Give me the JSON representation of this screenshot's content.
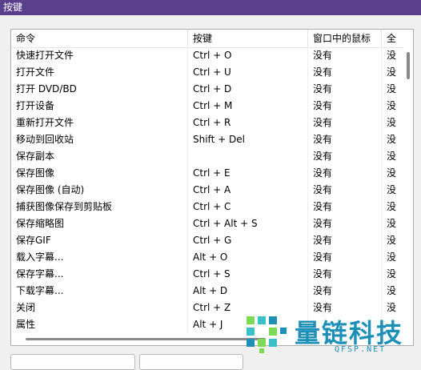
{
  "window": {
    "title": "按键"
  },
  "table": {
    "headers": [
      "命令",
      "按键",
      "窗口中的鼠标",
      "全"
    ],
    "rows": [
      [
        "快速打开文件",
        "Ctrl + O",
        "没有",
        "没"
      ],
      [
        "打开文件",
        "Ctrl + U",
        "没有",
        "没"
      ],
      [
        "打开 DVD/BD",
        "Ctrl + D",
        "没有",
        "没"
      ],
      [
        "打开设备",
        "Ctrl + M",
        "没有",
        "没"
      ],
      [
        "重新打开文件",
        "Ctrl + R",
        "没有",
        "没"
      ],
      [
        "移动到回收站",
        "Shift + Del",
        "没有",
        "没"
      ],
      [
        "保存副本",
        "",
        "没有",
        "没"
      ],
      [
        "保存图像",
        "Ctrl + E",
        "没有",
        "没"
      ],
      [
        "保存图像 (自动)",
        "Ctrl + A",
        "没有",
        "没"
      ],
      [
        "捕获图像保存到剪贴板",
        "Ctrl + C",
        "没有",
        "没"
      ],
      [
        "保存缩略图",
        "Ctrl + Alt + S",
        "没有",
        "没"
      ],
      [
        "保存GIF",
        "Ctrl + G",
        "没有",
        "没"
      ],
      [
        "载入字幕...",
        "Alt + O",
        "没有",
        "没"
      ],
      [
        "保存字幕...",
        "Ctrl + S",
        "没有",
        "没"
      ],
      [
        "下载字幕...",
        "Alt + D",
        "没有",
        "没"
      ],
      [
        "关闭",
        "Ctrl + Z",
        "没有",
        "没"
      ],
      [
        "属性",
        "Alt + J",
        "",
        ""
      ]
    ]
  },
  "watermark": {
    "text": "量链科技",
    "url": "QFSP.NET"
  }
}
